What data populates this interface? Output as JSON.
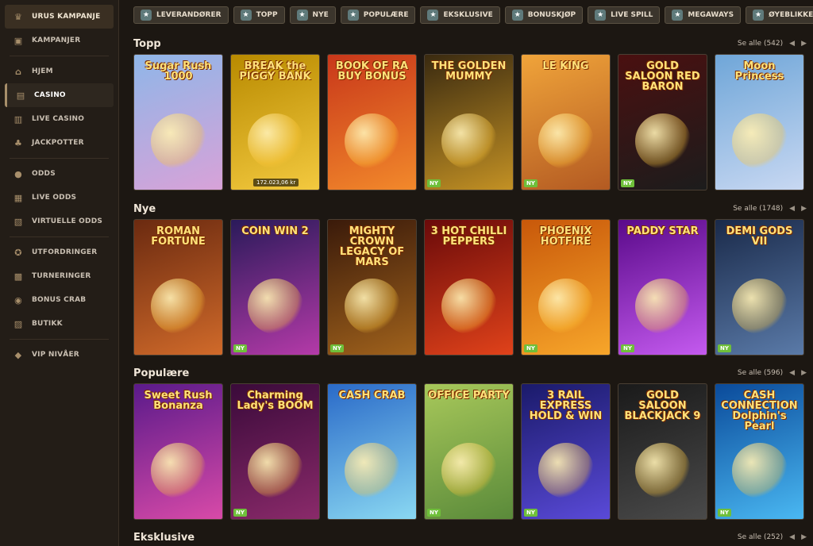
{
  "sidebar": {
    "items": [
      {
        "label": "URUS KAMPANJE",
        "icon": "trophy-icon"
      },
      {
        "label": "KAMPANJER",
        "icon": "gift-icon"
      },
      {
        "label": "HJEM",
        "icon": "home-icon"
      },
      {
        "label": "CASINO",
        "icon": "casino-icon"
      },
      {
        "label": "LIVE CASINO",
        "icon": "live-casino-icon"
      },
      {
        "label": "JACKPOTTER",
        "icon": "clover-icon"
      },
      {
        "label": "ODDS",
        "icon": "ball-icon"
      },
      {
        "label": "LIVE ODDS",
        "icon": "live-odds-icon"
      },
      {
        "label": "VIRTUELLE ODDS",
        "icon": "virtual-odds-icon"
      },
      {
        "label": "UTFORDRINGER",
        "icon": "challenge-icon"
      },
      {
        "label": "TURNERINGER",
        "icon": "tournament-icon"
      },
      {
        "label": "BONUS CRAB",
        "icon": "crab-icon"
      },
      {
        "label": "BUTIKK",
        "icon": "shop-icon"
      },
      {
        "label": "VIP NIVÅER",
        "icon": "diamond-icon"
      }
    ]
  },
  "topnav": [
    {
      "label": "LEVERANDØRER",
      "icon": "providers-icon"
    },
    {
      "label": "TOPP",
      "icon": "top-icon"
    },
    {
      "label": "NYE",
      "icon": "new-icon"
    },
    {
      "label": "POPULÆRE",
      "icon": "popular-icon"
    },
    {
      "label": "EKSKLUSIVE",
      "icon": "exclusive-icon"
    },
    {
      "label": "BONUSKJØP",
      "icon": "bonus-buy-icon"
    },
    {
      "label": "LIVE SPILL",
      "icon": "live-games-icon"
    },
    {
      "label": "MEGAWAYS",
      "icon": "megaways-icon"
    },
    {
      "label": "ØYEBLIKKELIGE SPILL",
      "icon": "instant-games-icon"
    }
  ],
  "sections": [
    {
      "title": "Topp",
      "see_all": "Se alle (542)",
      "games": [
        {
          "title": "Sugar Rush 1000",
          "ny": ""
        },
        {
          "title": "BREAK the PIGGY BANK",
          "jackpot": "172.023,06 kr",
          "ny": ""
        },
        {
          "title": "BOOK OF RA BUY BONUS",
          "ny": ""
        },
        {
          "title": "THE GOLDEN MUMMY",
          "ny": "NY"
        },
        {
          "title": "LE KING",
          "ny": "NY"
        },
        {
          "title": "GOLD SALOON RED BARON",
          "ny": "NY"
        },
        {
          "title": "Moon Princess",
          "ny": ""
        }
      ]
    },
    {
      "title": "Nye",
      "see_all": "Se alle (1748)",
      "games": [
        {
          "title": "ROMAN FORTUNE",
          "ny": ""
        },
        {
          "title": "COIN WIN 2",
          "ny": "NY"
        },
        {
          "title": "MIGHTY CROWN LEGACY OF MARS",
          "ny": "NY"
        },
        {
          "title": "3 HOT CHILLI PEPPERS",
          "ny": ""
        },
        {
          "title": "PHOENIX HOTFIRE",
          "ny": "NY"
        },
        {
          "title": "PADDY STAR",
          "ny": "NY"
        },
        {
          "title": "DEMI GODS VII",
          "ny": "NY"
        }
      ]
    },
    {
      "title": "Populære",
      "see_all": "Se alle (596)",
      "games": [
        {
          "title": "Sweet Rush Bonanza",
          "ny": ""
        },
        {
          "title": "Charming Lady's BOOM",
          "ny": "NY"
        },
        {
          "title": "CASH CRAB",
          "ny": ""
        },
        {
          "title": "OFFICE PARTY",
          "ny": "NY"
        },
        {
          "title": "3 RAIL EXPRESS HOLD & WIN",
          "ny": "NY"
        },
        {
          "title": "GOLD SALOON BLACKJACK 9",
          "ny": ""
        },
        {
          "title": "CASH CONNECTION Dolphin's Pearl",
          "ny": "NY"
        }
      ]
    },
    {
      "title": "Eksklusive",
      "see_all": "Se alle (252)",
      "games": []
    }
  ],
  "colors": {
    "card_bgs": [
      [
        "#8fb6e8",
        "#d8a2d8"
      ],
      [
        "#b88a00",
        "#f3c93f"
      ],
      [
        "#c8371a",
        "#f2892b"
      ],
      [
        "#3a2a10",
        "#c39124"
      ],
      [
        "#f0a43a",
        "#b35a22"
      ],
      [
        "#4a1010",
        "#1c1c1c"
      ],
      [
        "#6fa6d8",
        "#c8d8f2"
      ],
      [
        "#6b2a10",
        "#d06a2a"
      ],
      [
        "#2a1a5a",
        "#b43aa8"
      ],
      [
        "#3a1a0a",
        "#a0621c"
      ],
      [
        "#6a0a0a",
        "#e0421a"
      ],
      [
        "#c8580a",
        "#f7a62a"
      ],
      [
        "#5a0a8a",
        "#c45aef"
      ],
      [
        "#1a2a4a",
        "#5a7aa8"
      ],
      [
        "#5a1a8a",
        "#d84aa8"
      ],
      [
        "#3a0a3a",
        "#8a2a6a"
      ],
      [
        "#2a6ac8",
        "#8ad8f2"
      ],
      [
        "#a8c85a",
        "#5a8a3a"
      ],
      [
        "#1a1a6a",
        "#5a4ad8"
      ],
      [
        "#1a1a1a",
        "#4a4a4a"
      ],
      [
        "#0a4a9a",
        "#4ab8f2"
      ]
    ]
  }
}
